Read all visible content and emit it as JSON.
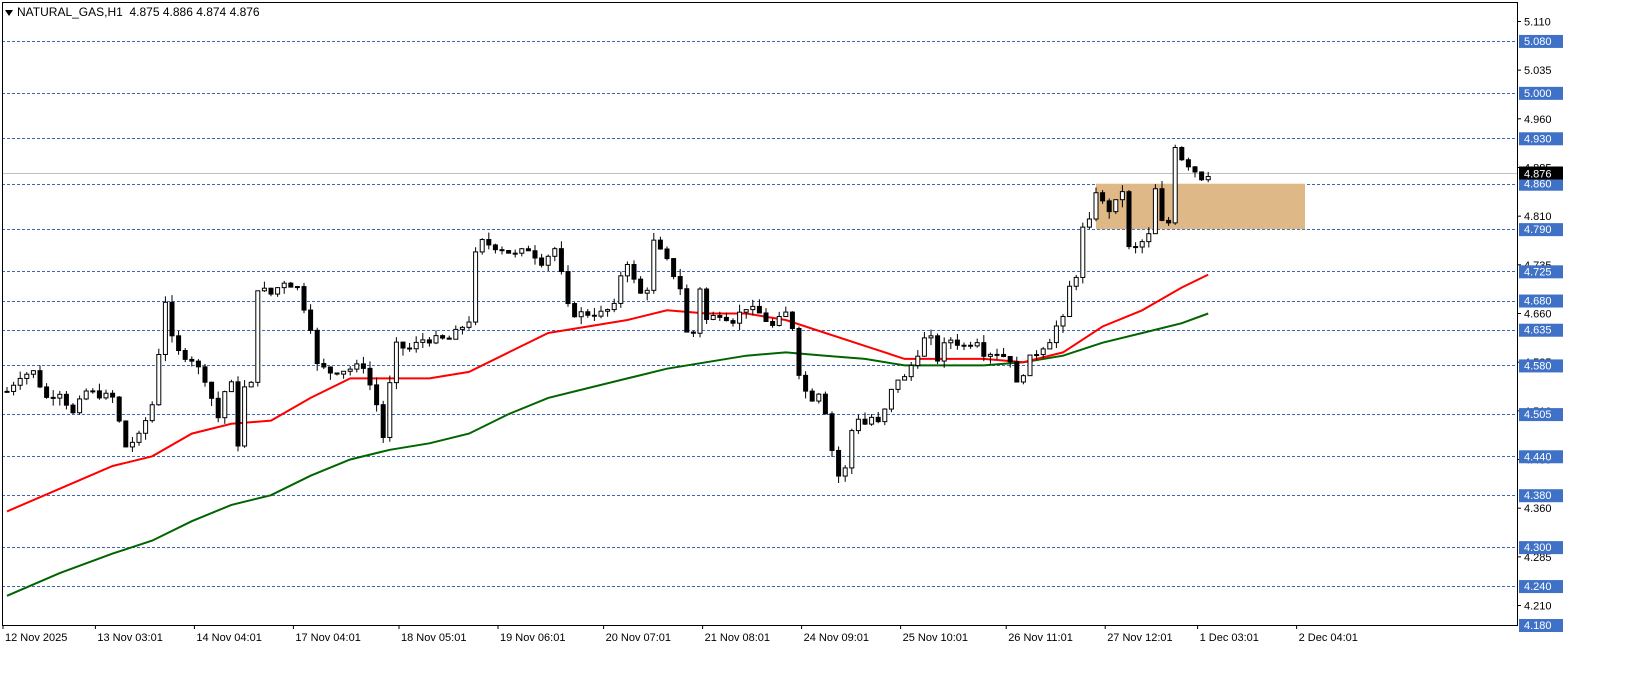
{
  "header": {
    "symbol_line": "NATURAL_GAS,H1  4.875 4.886 4.874 4.876"
  },
  "colors": {
    "background": "#ffffff",
    "candle": "#000000",
    "ma_fast": "#ff0000",
    "ma_slow": "#006400",
    "level_line": "#3c64b4",
    "level_label_bg": "#3f71c6",
    "zone_fill": "#deb887",
    "price_line": "#c0c0c0"
  },
  "chart_data": {
    "type": "candlestick",
    "symbol": "NATURAL_GAS",
    "timeframe": "H1",
    "ylim": [
      4.18,
      5.14
    ],
    "y_ticks": [
      "5.110",
      "5.035",
      "4.960",
      "4.885",
      "4.810",
      "4.735",
      "4.660",
      "4.585",
      "4.510",
      "4.435",
      "4.360",
      "4.285",
      "4.210"
    ],
    "x_labels": [
      "12 Nov 2025",
      "13 Nov 03:01",
      "14 Nov 04:01",
      "17 Nov 04:01",
      "18 Nov 05:01",
      "19 Nov 06:01",
      "20 Nov 07:01",
      "21 Nov 08:01",
      "24 Nov 09:01",
      "25 Nov 10:01",
      "26 Nov 11:01",
      "27 Nov 12:01",
      "1 Dec 03:01",
      "2 Dec 04:01"
    ],
    "horizontal_levels": [
      "5.080",
      "5.000",
      "4.930",
      "4.860",
      "4.790",
      "4.725",
      "4.680",
      "4.635",
      "4.580",
      "4.505",
      "4.440",
      "4.380",
      "4.300",
      "4.240",
      "4.180"
    ],
    "current_price": "4.876",
    "zone": {
      "low": 4.79,
      "high": 4.86
    },
    "price_path": [
      [
        0,
        4.54
      ],
      [
        2,
        4.565
      ],
      [
        4,
        4.57
      ],
      [
        6,
        4.53
      ],
      [
        8,
        4.54
      ],
      [
        10,
        4.505
      ],
      [
        12,
        4.54
      ],
      [
        14,
        4.535
      ],
      [
        16,
        4.53
      ],
      [
        18,
        4.455
      ],
      [
        20,
        4.47
      ],
      [
        22,
        4.52
      ],
      [
        23,
        4.6
      ],
      [
        24,
        4.68
      ],
      [
        25,
        4.62
      ],
      [
        26,
        4.6
      ],
      [
        28,
        4.59
      ],
      [
        30,
        4.56
      ],
      [
        32,
        4.5
      ],
      [
        33,
        4.54
      ],
      [
        34,
        4.55
      ],
      [
        35,
        4.46
      ],
      [
        36,
        4.545
      ],
      [
        37,
        4.55
      ],
      [
        38,
        4.7
      ],
      [
        40,
        4.69
      ],
      [
        42,
        4.71
      ],
      [
        44,
        4.7
      ],
      [
        46,
        4.64
      ],
      [
        47,
        4.58
      ],
      [
        49,
        4.57
      ],
      [
        52,
        4.575
      ],
      [
        54,
        4.58
      ],
      [
        56,
        4.52
      ],
      [
        57,
        4.47
      ],
      [
        58,
        4.55
      ],
      [
        59,
        4.61
      ],
      [
        61,
        4.605
      ],
      [
        63,
        4.62
      ],
      [
        65,
        4.62
      ],
      [
        67,
        4.62
      ],
      [
        69,
        4.64
      ],
      [
        70,
        4.65
      ],
      [
        71,
        4.75
      ],
      [
        72,
        4.77
      ],
      [
        75,
        4.76
      ],
      [
        77,
        4.75
      ],
      [
        79,
        4.76
      ],
      [
        81,
        4.74
      ],
      [
        83,
        4.76
      ],
      [
        84,
        4.72
      ],
      [
        85,
        4.67
      ],
      [
        86,
        4.66
      ],
      [
        88,
        4.66
      ],
      [
        90,
        4.66
      ],
      [
        92,
        4.67
      ],
      [
        93,
        4.72
      ],
      [
        94,
        4.74
      ],
      [
        95,
        4.71
      ],
      [
        96,
        4.69
      ],
      [
        97,
        4.7
      ],
      [
        98,
        4.77
      ],
      [
        100,
        4.74
      ],
      [
        102,
        4.7
      ],
      [
        103,
        4.63
      ],
      [
        104,
        4.63
      ],
      [
        105,
        4.7
      ],
      [
        106,
        4.65
      ],
      [
        108,
        4.66
      ],
      [
        110,
        4.65
      ],
      [
        112,
        4.67
      ],
      [
        114,
        4.66
      ],
      [
        116,
        4.64
      ],
      [
        118,
        4.66
      ],
      [
        119,
        4.64
      ],
      [
        120,
        4.57
      ],
      [
        121,
        4.54
      ],
      [
        122,
        4.53
      ],
      [
        123,
        4.54
      ],
      [
        124,
        4.51
      ],
      [
        125,
        4.45
      ],
      [
        126,
        4.41
      ],
      [
        127,
        4.42
      ],
      [
        128,
        4.48
      ],
      [
        129,
        4.5
      ],
      [
        130,
        4.49
      ],
      [
        131,
        4.5
      ],
      [
        132,
        4.49
      ],
      [
        133,
        4.51
      ],
      [
        134,
        4.54
      ],
      [
        135,
        4.56
      ],
      [
        136,
        4.56
      ],
      [
        137,
        4.58
      ],
      [
        138,
        4.6
      ],
      [
        139,
        4.62
      ],
      [
        140,
        4.62
      ],
      [
        141,
        4.59
      ],
      [
        142,
        4.61
      ],
      [
        143,
        4.62
      ],
      [
        145,
        4.61
      ],
      [
        147,
        4.62
      ],
      [
        148,
        4.6
      ],
      [
        150,
        4.6
      ],
      [
        152,
        4.59
      ],
      [
        153,
        4.55
      ],
      [
        155,
        4.59
      ],
      [
        157,
        4.61
      ],
      [
        158,
        4.62
      ],
      [
        159,
        4.64
      ],
      [
        160,
        4.65
      ],
      [
        161,
        4.7
      ],
      [
        162,
        4.72
      ],
      [
        163,
        4.79
      ],
      [
        164,
        4.8
      ],
      [
        165,
        4.85
      ],
      [
        166,
        4.83
      ],
      [
        167,
        4.82
      ],
      [
        168,
        4.83
      ],
      [
        169,
        4.85
      ],
      [
        170,
        4.76
      ],
      [
        171,
        4.76
      ],
      [
        172,
        4.77
      ],
      [
        173,
        4.78
      ],
      [
        174,
        4.85
      ],
      [
        175,
        4.8
      ],
      [
        176,
        4.8
      ],
      [
        177,
        4.92
      ],
      [
        178,
        4.9
      ],
      [
        179,
        4.89
      ],
      [
        180,
        4.88
      ],
      [
        181,
        4.87
      ],
      [
        182,
        4.876
      ]
    ],
    "ma_fast_path": [
      [
        0,
        4.355
      ],
      [
        8,
        4.39
      ],
      [
        16,
        4.425
      ],
      [
        22,
        4.44
      ],
      [
        28,
        4.475
      ],
      [
        34,
        4.49
      ],
      [
        40,
        4.495
      ],
      [
        46,
        4.53
      ],
      [
        52,
        4.56
      ],
      [
        58,
        4.56
      ],
      [
        64,
        4.56
      ],
      [
        70,
        4.57
      ],
      [
        76,
        4.6
      ],
      [
        82,
        4.63
      ],
      [
        88,
        4.64
      ],
      [
        94,
        4.65
      ],
      [
        100,
        4.665
      ],
      [
        106,
        4.66
      ],
      [
        112,
        4.66
      ],
      [
        118,
        4.65
      ],
      [
        124,
        4.63
      ],
      [
        130,
        4.61
      ],
      [
        136,
        4.59
      ],
      [
        142,
        4.59
      ],
      [
        148,
        4.59
      ],
      [
        154,
        4.585
      ],
      [
        160,
        4.6
      ],
      [
        166,
        4.64
      ],
      [
        172,
        4.665
      ],
      [
        178,
        4.7
      ],
      [
        182,
        4.72
      ]
    ],
    "ma_slow_path": [
      [
        0,
        4.225
      ],
      [
        8,
        4.26
      ],
      [
        16,
        4.29
      ],
      [
        22,
        4.31
      ],
      [
        28,
        4.34
      ],
      [
        34,
        4.365
      ],
      [
        40,
        4.38
      ],
      [
        46,
        4.41
      ],
      [
        52,
        4.435
      ],
      [
        58,
        4.45
      ],
      [
        64,
        4.46
      ],
      [
        70,
        4.475
      ],
      [
        76,
        4.505
      ],
      [
        82,
        4.53
      ],
      [
        88,
        4.545
      ],
      [
        94,
        4.56
      ],
      [
        100,
        4.575
      ],
      [
        106,
        4.585
      ],
      [
        112,
        4.595
      ],
      [
        118,
        4.6
      ],
      [
        124,
        4.595
      ],
      [
        130,
        4.59
      ],
      [
        136,
        4.58
      ],
      [
        142,
        4.58
      ],
      [
        148,
        4.58
      ],
      [
        154,
        4.585
      ],
      [
        160,
        4.595
      ],
      [
        166,
        4.615
      ],
      [
        172,
        4.63
      ],
      [
        178,
        4.645
      ],
      [
        182,
        4.66
      ]
    ]
  }
}
